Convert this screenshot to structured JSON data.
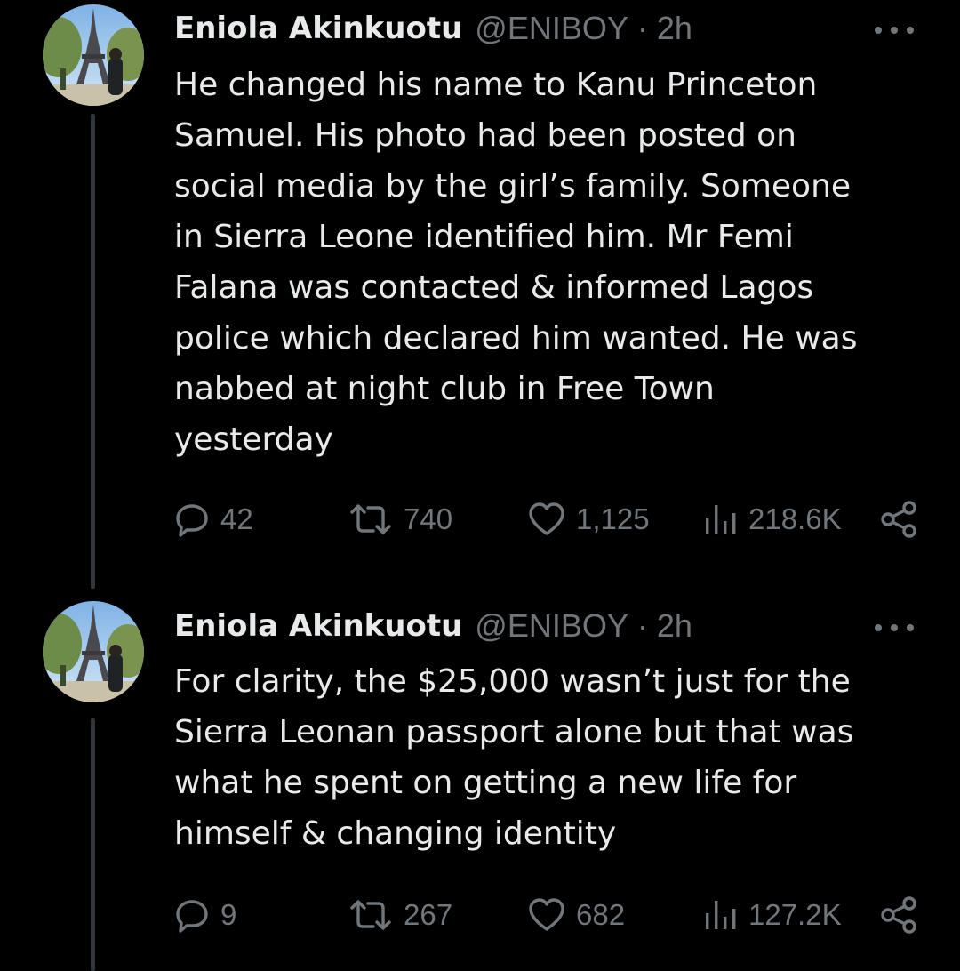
{
  "colors": {
    "background": "#000000",
    "text": "#e7e9ea",
    "muted": "#71767b",
    "thread_line": "#333639"
  },
  "tweets": [
    {
      "author": {
        "name": "Eniola Akinkuotu",
        "handle": "@ENIBOY",
        "separator": "·",
        "time": "2h",
        "avatar_icon": "avatar-eiffel-tower-photo"
      },
      "text": "He changed his name to Kanu Princeton\nSamuel. His photo had been posted on\nsocial media by the girl’s family. Someone\nin Sierra Leone identified him. Mr Femi\nFalana was contacted & informed Lagos\npolice which declared him wanted. He was\nnabbed at night club in Free Town\nyesterday",
      "actions": {
        "replies": "42",
        "reposts": "740",
        "likes": "1,125",
        "views": "218.6K"
      }
    },
    {
      "author": {
        "name": "Eniola Akinkuotu",
        "handle": "@ENIBOY",
        "separator": "·",
        "time": "2h",
        "avatar_icon": "avatar-eiffel-tower-photo"
      },
      "text": "For clarity, the $25,000 wasn’t just for the\nSierra Leonan passport alone but that was\nwhat he spent on getting a new life for\nhimself & changing identity",
      "actions": {
        "replies": "9",
        "reposts": "267",
        "likes": "682",
        "views": "127.2K"
      }
    }
  ],
  "icons": {
    "reply": "reply-icon",
    "repost": "repost-icon",
    "like": "heart-icon",
    "views": "views-chart-icon",
    "share": "share-icon",
    "more": "more-dots-icon"
  }
}
